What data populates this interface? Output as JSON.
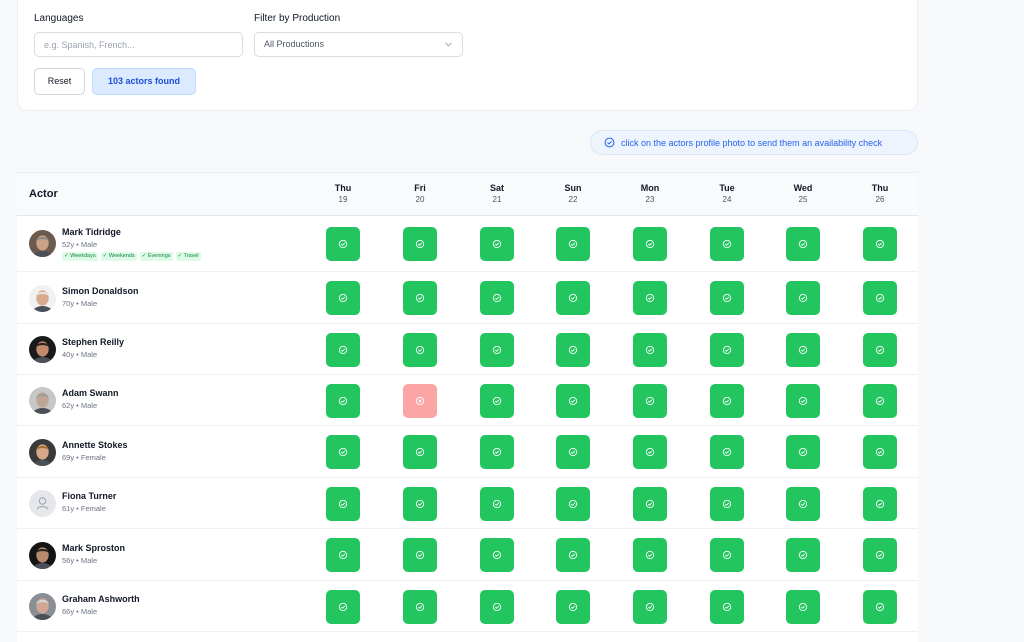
{
  "filters": {
    "languages_label": "Languages",
    "languages_placeholder": "e.g. Spanish, French...",
    "production_label": "Filter by Production",
    "production_value": "All Productions",
    "reset_label": "Reset",
    "found_label": "103 actors found"
  },
  "hint": {
    "text": "click on the actors profile photo to send them an availability check"
  },
  "table": {
    "actor_header": "Actor",
    "days": [
      {
        "name": "Thu",
        "date": "19"
      },
      {
        "name": "Fri",
        "date": "20"
      },
      {
        "name": "Sat",
        "date": "21"
      },
      {
        "name": "Sun",
        "date": "22"
      },
      {
        "name": "Mon",
        "date": "23"
      },
      {
        "name": "Tue",
        "date": "24"
      },
      {
        "name": "Wed",
        "date": "25"
      },
      {
        "name": "Thu",
        "date": "26"
      }
    ],
    "actors": [
      {
        "name": "Mark Tidridge",
        "meta": "52y • Male",
        "tags": [
          "✓ Weekdays",
          "✓ Weekends",
          "✓ Evenings",
          "✓ Travel"
        ],
        "avatar": "photo",
        "skin": "#c9a184",
        "hair": "#8a8a8a",
        "bg": "#6b5b4f",
        "availability": [
          true,
          true,
          true,
          true,
          true,
          true,
          true,
          true
        ]
      },
      {
        "name": "Simon Donaldson",
        "meta": "70y • Male",
        "tags": [],
        "avatar": "photo",
        "skin": "#d9a98c",
        "hair": "#e5e5e5",
        "bg": "#f1f1f1",
        "availability": [
          true,
          true,
          true,
          true,
          true,
          true,
          true,
          true
        ]
      },
      {
        "name": "Stephen Reilly",
        "meta": "40y • Male",
        "tags": [],
        "avatar": "photo",
        "skin": "#c08a6b",
        "hair": "#2b2420",
        "bg": "#1a1a1a",
        "availability": [
          true,
          true,
          true,
          true,
          true,
          true,
          true,
          true
        ]
      },
      {
        "name": "Adam Swann",
        "meta": "62y • Male",
        "tags": [],
        "avatar": "photo",
        "skin": "#bfa596",
        "hair": "#9a9a9a",
        "bg": "#c7c7c7",
        "availability": [
          true,
          false,
          true,
          true,
          true,
          true,
          true,
          true
        ]
      },
      {
        "name": "Annette Stokes",
        "meta": "69y • Female",
        "tags": [],
        "avatar": "photo",
        "skin": "#d6a88a",
        "hair": "#a8702e",
        "bg": "#3a3a3a",
        "availability": [
          true,
          true,
          true,
          true,
          true,
          true,
          true,
          true
        ]
      },
      {
        "name": "Fiona Turner",
        "meta": "61y • Female",
        "tags": [],
        "avatar": "placeholder",
        "availability": [
          true,
          true,
          true,
          true,
          true,
          true,
          true,
          true
        ]
      },
      {
        "name": "Mark Sproston",
        "meta": "56y • Male",
        "tags": [],
        "avatar": "photo",
        "skin": "#b78a6e",
        "hair": "#2a2420",
        "bg": "#141414",
        "availability": [
          true,
          true,
          true,
          true,
          true,
          true,
          true,
          true
        ]
      },
      {
        "name": "Graham Ashworth",
        "meta": "66y • Male",
        "tags": [],
        "avatar": "photo",
        "skin": "#d0a892",
        "hair": "#d5d5d5",
        "bg": "#8a8f96",
        "availability": [
          true,
          true,
          true,
          true,
          true,
          true,
          true,
          true
        ]
      }
    ]
  },
  "colors": {
    "available": "#22c55e",
    "unavailable": "#fca5a5",
    "accent": "#2563eb"
  },
  "icons": {
    "available": "check-circle-icon",
    "unavailable": "x-circle-icon",
    "hint": "check-circle-icon",
    "placeholder_avatar": "user-icon",
    "select": "chevron-down-icon"
  }
}
